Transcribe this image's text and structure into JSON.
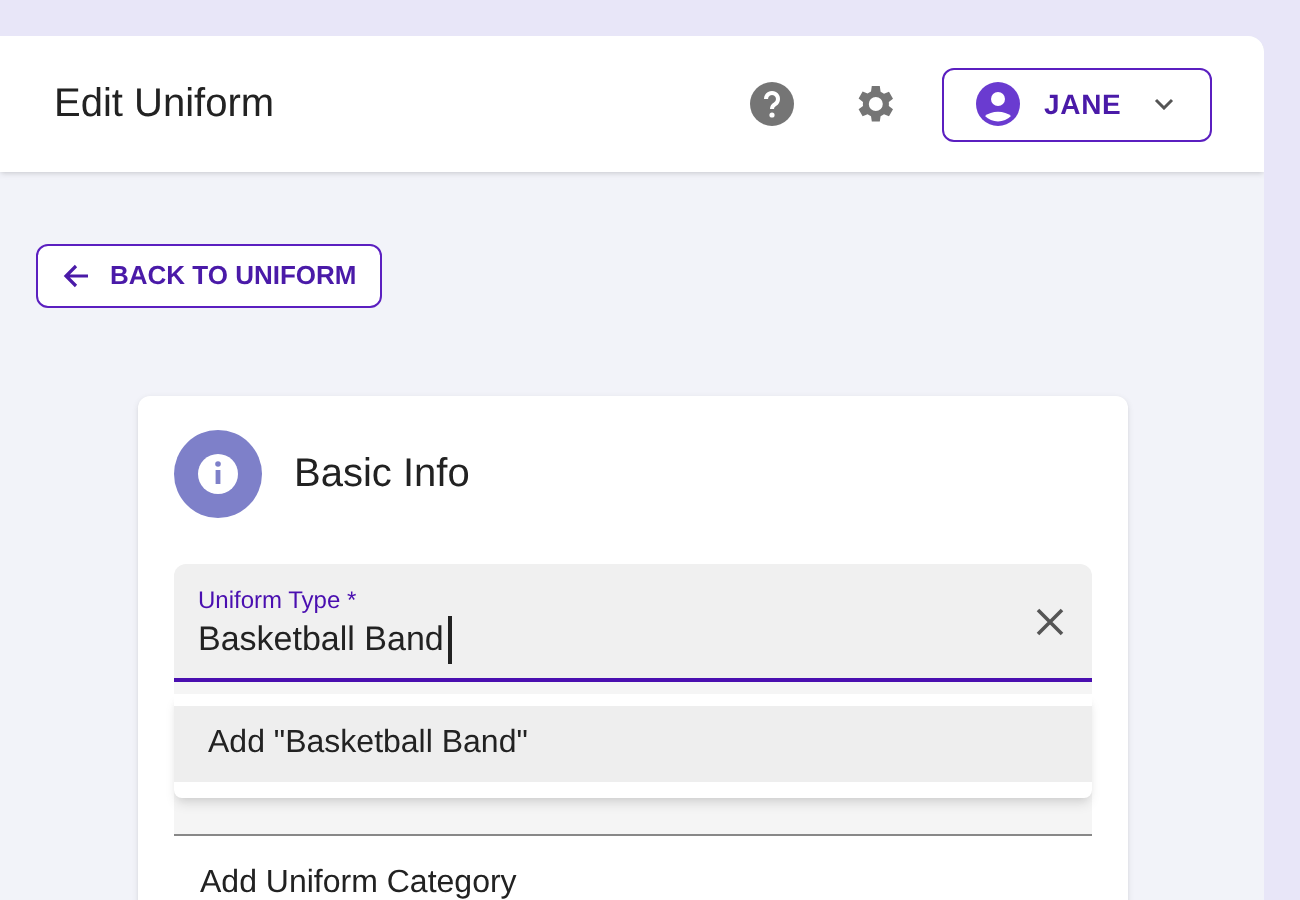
{
  "header": {
    "title": "Edit Uniform",
    "user_button": {
      "label": "JANE"
    }
  },
  "back_button": {
    "label": "BACK TO UNIFORM"
  },
  "card": {
    "title": "Basic Info",
    "field": {
      "label": "Uniform Type *",
      "value": "Basketball Band",
      "focused": true
    },
    "dropdown": {
      "options": [
        {
          "label": "Add \"Basketball Band\"",
          "selected": true
        }
      ]
    },
    "link": "Add Uniform Category"
  }
}
